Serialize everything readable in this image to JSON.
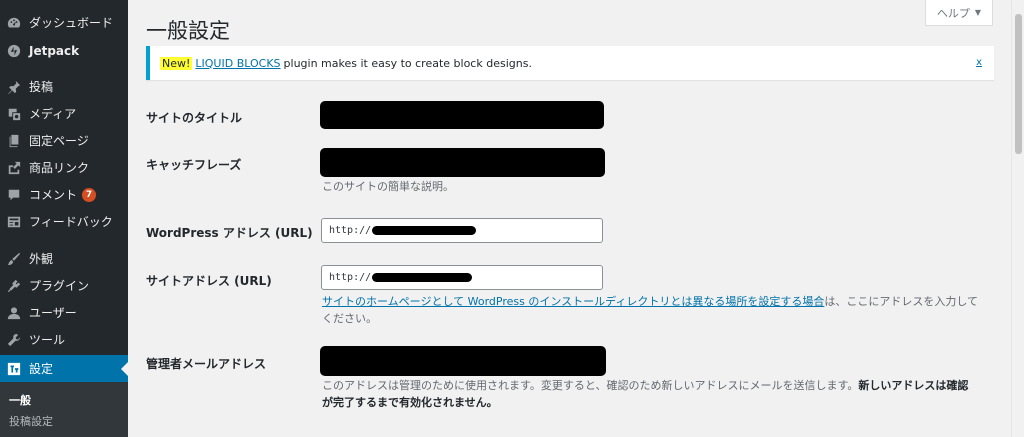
{
  "sidebar": {
    "items": [
      {
        "label": "ダッシュボード",
        "icon": "dashboard-icon"
      },
      {
        "label": "Jetpack",
        "icon": "jetpack-icon"
      },
      {
        "label": "投稿",
        "icon": "pin-icon"
      },
      {
        "label": "メディア",
        "icon": "media-icon"
      },
      {
        "label": "固定ページ",
        "icon": "pages-icon"
      },
      {
        "label": "商品リンク",
        "icon": "link-out-icon"
      },
      {
        "label": "コメント",
        "icon": "comment-icon",
        "badge": "7"
      },
      {
        "label": "フィードバック",
        "icon": "feedback-icon"
      },
      {
        "label": "外観",
        "icon": "brush-icon"
      },
      {
        "label": "プラグイン",
        "icon": "plugin-icon"
      },
      {
        "label": "ユーザー",
        "icon": "user-icon"
      },
      {
        "label": "ツール",
        "icon": "wrench-icon"
      },
      {
        "label": "設定",
        "icon": "settings-icon",
        "active": true
      }
    ],
    "submenu": [
      "一般",
      "投稿設定"
    ]
  },
  "page": {
    "title": "一般設定",
    "help_label": "ヘルプ"
  },
  "notice": {
    "new_label": "New!",
    "link_text": "LIQUID BLOCKS",
    "message": "plugin makes it easy to create block designs.",
    "dismiss": "x"
  },
  "form": {
    "site_title_label": "サイトのタイトル",
    "tagline_label": "キャッチフレーズ",
    "tagline_desc": "このサイトの簡単な説明。",
    "wp_address_label": "WordPress アドレス (URL)",
    "wp_address_value": "http://",
    "site_address_label": "サイトアドレス (URL)",
    "site_address_value": "http://",
    "site_address_link": "サイトのホームページとして WordPress のインストールディレクトリとは異なる場所を設定する場合",
    "site_address_desc_tail": "は、ここにアドレスを入力して",
    "site_address_desc_line2": "ください。",
    "admin_email_label": "管理者メールアドレス",
    "admin_email_desc": "このアドレスは管理のために使用されます。変更すると、確認のため新しいアドレスにメールを送信します。",
    "admin_email_desc_bold1": "新しいアドレスは確認",
    "admin_email_desc_bold2": "が完了するまで有効化されません。"
  },
  "colors": {
    "sidebar_bg": "#23282d",
    "active": "#0073aa",
    "notice_border": "#00a0d2",
    "badge": "#d54e21",
    "highlight": "#ffff33"
  }
}
